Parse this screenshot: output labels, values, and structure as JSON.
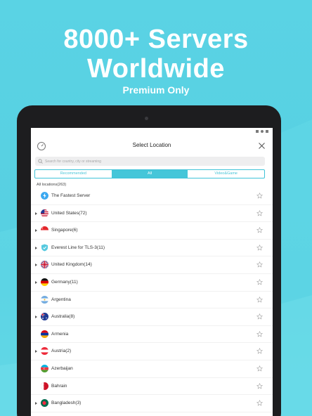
{
  "promo": {
    "headline_1": "8000+ Servers",
    "headline_2": "Worldwide",
    "subtitle": "Premium Only"
  },
  "app": {
    "title": "Select Location",
    "search_placeholder": "Search for country, city or streaming",
    "tabs": [
      {
        "label": "Recommended",
        "active": false
      },
      {
        "label": "All",
        "active": true
      },
      {
        "label": "Video&Game",
        "active": false
      }
    ],
    "list_header": "All locations(263)",
    "locations": [
      {
        "label": "The Fastest Server",
        "icon": "bolt-icon",
        "expandable": false
      },
      {
        "label": "United States(72)",
        "icon": "flag-us-icon",
        "expandable": true
      },
      {
        "label": "Singapore(6)",
        "icon": "flag-sg-icon",
        "expandable": true
      },
      {
        "label": "Everest Line for TLS-3(11)",
        "icon": "shield-icon",
        "expandable": true
      },
      {
        "label": "United Kingdom(14)",
        "icon": "flag-uk-icon",
        "expandable": true
      },
      {
        "label": "Germany(11)",
        "icon": "flag-de-icon",
        "expandable": true
      },
      {
        "label": "Argentina",
        "icon": "flag-ar-icon",
        "expandable": false
      },
      {
        "label": "Australia(8)",
        "icon": "flag-au-icon",
        "expandable": true
      },
      {
        "label": "Armenia",
        "icon": "flag-am-icon",
        "expandable": false
      },
      {
        "label": "Austria(2)",
        "icon": "flag-at-icon",
        "expandable": true
      },
      {
        "label": "Azerbaijan",
        "icon": "flag-az-icon",
        "expandable": false
      },
      {
        "label": "Bahrain",
        "icon": "flag-bh-icon",
        "expandable": false
      },
      {
        "label": "Bangladesh(3)",
        "icon": "flag-bd-icon",
        "expandable": true
      }
    ]
  },
  "colors": {
    "accent": "#45c6d9",
    "background": "#56cfe1"
  }
}
